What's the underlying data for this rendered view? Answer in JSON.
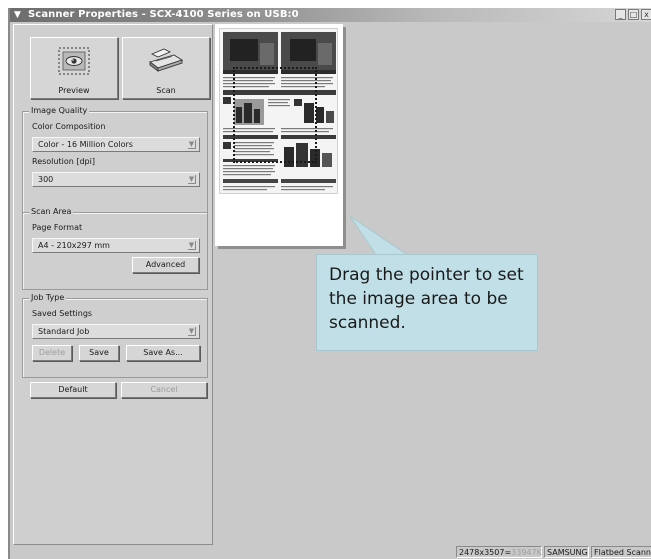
{
  "window": {
    "title": "Scanner Properties - SCX-4100 Series on USB:0",
    "minimize_label": "_",
    "maximize_label": "□",
    "close_label": "x"
  },
  "toolbar": {
    "preview_label": "Preview",
    "scan_label": "Scan"
  },
  "image_quality": {
    "legend": "Image Quality",
    "color_label": "Color Composition",
    "color_value": "Color - 16 Million Colors",
    "resolution_label": "Resolution [dpi]",
    "resolution_value": "300"
  },
  "scan_area": {
    "legend": "Scan Area",
    "format_label": "Page Format",
    "format_value": "A4 - 210x297 mm",
    "advanced_label": "Advanced"
  },
  "job_type": {
    "legend": "Job Type",
    "saved_label": "Saved Settings",
    "saved_value": "Standard Job",
    "delete_label": "Delete",
    "save_label": "Save",
    "save_as_label": "Save As..."
  },
  "footer": {
    "default_label": "Default",
    "cancel_label": "Cancel"
  },
  "callout": {
    "text": "Drag the pointer to set the image area to be scanned."
  },
  "status": {
    "dimensions": "2478x3507=",
    "filesize": "33947K",
    "brand": "SAMSUNG",
    "scanner": "Flatbed Scanner"
  },
  "icons": {
    "window_menu": "chevron-down-icon",
    "preview": "preview-eye-icon",
    "scan": "flatbed-scanner-icon"
  }
}
